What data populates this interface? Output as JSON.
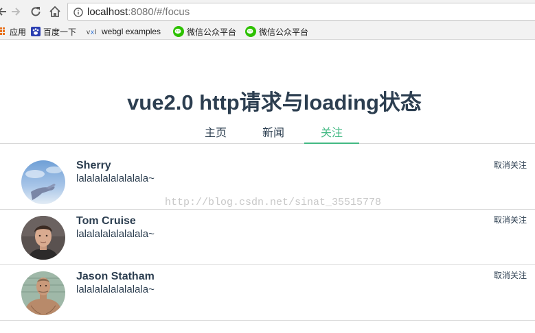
{
  "browser": {
    "url_host": "localhost",
    "url_rest": ":8080/#/focus"
  },
  "bookmarks": [
    {
      "label": "应用",
      "icon": "apps-grid-icon"
    },
    {
      "label": "百度一下",
      "icon": "baidu-paw-icon"
    },
    {
      "label": "webgl examples",
      "icon": "vxl-icon"
    },
    {
      "label": "微信公众平台",
      "icon": "wechat-icon"
    },
    {
      "label": "微信公众平台",
      "icon": "wechat-icon"
    }
  ],
  "page": {
    "title": "vue2.0 http请求与loading状态",
    "tabs": [
      {
        "label": "主页",
        "active": false
      },
      {
        "label": "新闻",
        "active": false
      },
      {
        "label": "关注",
        "active": true
      }
    ],
    "accent_color": "#42b983",
    "text_color": "#2c3e50"
  },
  "users": [
    {
      "name": "Sherry",
      "desc": "lalalalalalalalala~",
      "action": "取消关注",
      "avatar": "sky-hand-avatar"
    },
    {
      "name": "Tom Cruise",
      "desc": "lalalalalalalalala~",
      "action": "取消关注",
      "avatar": "portrait-avatar"
    },
    {
      "name": "Jason Statham",
      "desc": "lalalalalalalalala~",
      "action": "取消关注",
      "avatar": "shirtless-man-avatar"
    }
  ],
  "watermark": "http://blog.csdn.net/sinat_35515778"
}
